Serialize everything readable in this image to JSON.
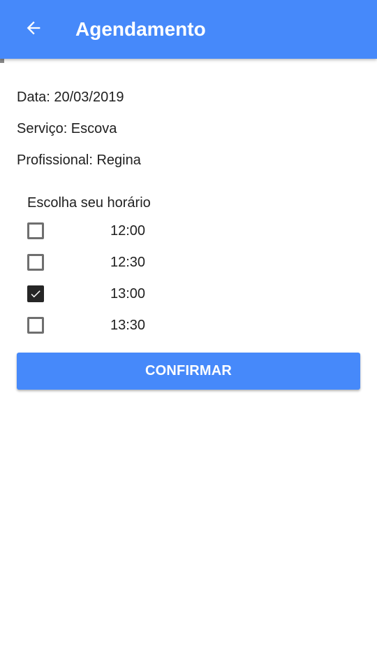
{
  "appbar": {
    "title": "Agendamento",
    "back_icon": "arrow-left-icon",
    "color": "#4689fa"
  },
  "details": {
    "date": "Data: 20/03/2019",
    "service": "Serviço: Escova",
    "professional": "Profissional: Regina"
  },
  "schedule": {
    "label": "Escolha seu horário",
    "slots": [
      {
        "time": "12:00",
        "checked": false
      },
      {
        "time": "12:30",
        "checked": false
      },
      {
        "time": "13:00",
        "checked": true
      },
      {
        "time": "13:30",
        "checked": false
      }
    ]
  },
  "confirm_button": {
    "label": "CONFIRMAR",
    "color": "#4689fa"
  }
}
